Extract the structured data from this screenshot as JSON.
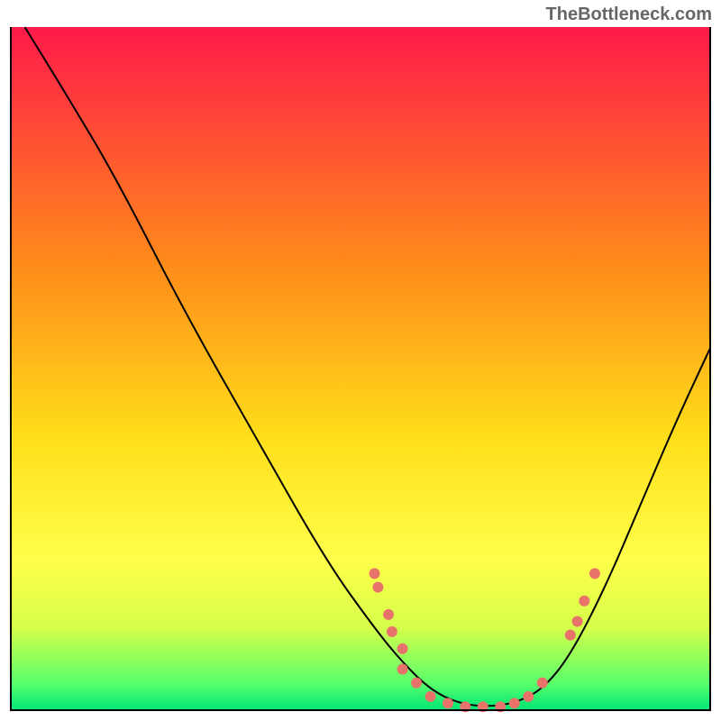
{
  "watermark": "TheBottleneck.com",
  "chart_data": {
    "type": "line",
    "title": "",
    "xlabel": "",
    "ylabel": "",
    "xlim": [
      0,
      100
    ],
    "ylim": [
      0,
      100
    ],
    "background": {
      "type": "vertical-gradient",
      "stops": [
        {
          "offset": 0,
          "color": "#ff1a4a"
        },
        {
          "offset": 0.35,
          "color": "#ff8c1a"
        },
        {
          "offset": 0.6,
          "color": "#ffde1a"
        },
        {
          "offset": 0.78,
          "color": "#ffff4a"
        },
        {
          "offset": 0.88,
          "color": "#d4ff4a"
        },
        {
          "offset": 0.96,
          "color": "#5aff6a"
        },
        {
          "offset": 1.0,
          "color": "#00e676"
        }
      ]
    },
    "curve": {
      "color": "#000000",
      "width": 2,
      "points": [
        {
          "x": 2,
          "y": 100
        },
        {
          "x": 8,
          "y": 90
        },
        {
          "x": 15,
          "y": 78
        },
        {
          "x": 25,
          "y": 58
        },
        {
          "x": 35,
          "y": 40
        },
        {
          "x": 45,
          "y": 22
        },
        {
          "x": 52,
          "y": 12
        },
        {
          "x": 56,
          "y": 7
        },
        {
          "x": 60,
          "y": 3
        },
        {
          "x": 64,
          "y": 1
        },
        {
          "x": 68,
          "y": 0.5
        },
        {
          "x": 72,
          "y": 1
        },
        {
          "x": 76,
          "y": 3
        },
        {
          "x": 80,
          "y": 8
        },
        {
          "x": 85,
          "y": 18
        },
        {
          "x": 90,
          "y": 30
        },
        {
          "x": 95,
          "y": 42
        },
        {
          "x": 100,
          "y": 53
        }
      ]
    },
    "markers": {
      "color": "#e8736b",
      "radius": 6,
      "points": [
        {
          "x": 52,
          "y": 20
        },
        {
          "x": 52.5,
          "y": 18
        },
        {
          "x": 54,
          "y": 14
        },
        {
          "x": 54.5,
          "y": 11.5
        },
        {
          "x": 56,
          "y": 9
        },
        {
          "x": 56,
          "y": 6
        },
        {
          "x": 58,
          "y": 4
        },
        {
          "x": 60,
          "y": 2
        },
        {
          "x": 62.5,
          "y": 1
        },
        {
          "x": 65,
          "y": 0.5
        },
        {
          "x": 67.5,
          "y": 0.5
        },
        {
          "x": 70,
          "y": 0.5
        },
        {
          "x": 72,
          "y": 1
        },
        {
          "x": 74,
          "y": 2
        },
        {
          "x": 76,
          "y": 4
        },
        {
          "x": 80,
          "y": 11
        },
        {
          "x": 81,
          "y": 13
        },
        {
          "x": 82,
          "y": 16
        },
        {
          "x": 83.5,
          "y": 20
        }
      ]
    }
  }
}
